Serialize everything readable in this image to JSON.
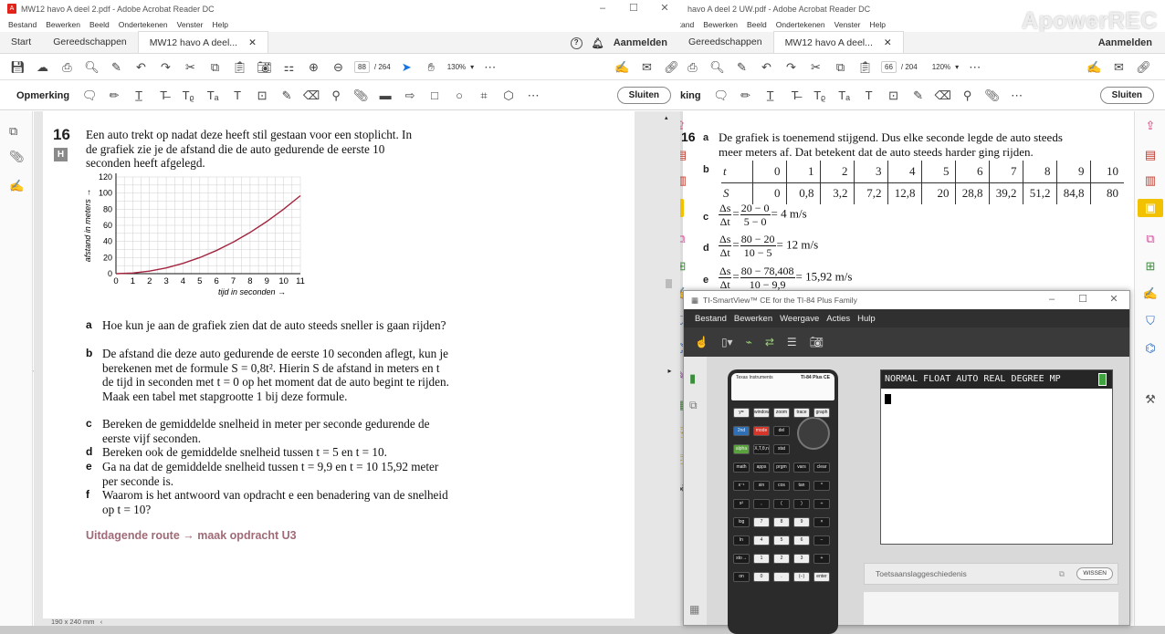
{
  "left_window": {
    "title": "MW12 havo A deel 2.pdf - Adobe Acrobat Reader DC",
    "menu": [
      "Bestand",
      "Bewerken",
      "Beeld",
      "Ondertekenen",
      "Venster",
      "Help"
    ],
    "tabs": {
      "start": "Start",
      "tools": "Gereedschappen",
      "doc": "MW12 havo A deel..."
    },
    "signin": "Aanmelden",
    "page_current": "88",
    "page_total": "/ 264",
    "zoom": "130%",
    "annot_label": "Opmerking",
    "close_label": "Sluiten",
    "status_size": "190 x 240 mm"
  },
  "exercise": {
    "number": "16",
    "badge": "H",
    "intro": "Een auto trekt op nadat deze heeft stil gestaan voor een stoplicht. In de grafiek zie je de afstand die de auto gedurende de eerste 10 seconden heeft afgelegd.",
    "questions": [
      {
        "letter": "a",
        "text": "Hoe kun je aan de grafiek zien dat de auto steeds sneller is gaan rijden?"
      },
      {
        "letter": "b",
        "text": "De afstand die deze auto gedurende de eerste 10 seconden aflegt, kun je berekenen met de formule S = 0,8t². Hierin S de afstand in meters en t de tijd in seconden met t = 0 op het moment dat de auto begint te rijden. Maak een tabel met stapgrootte 1 bij deze formule."
      },
      {
        "letter": "c",
        "text": "Bereken de gemiddelde snelheid in meter per seconde gedurende de eerste vijf seconden."
      },
      {
        "letter": "d",
        "text": "Bereken ook de gemiddelde snelheid tussen t = 5 en t = 10."
      },
      {
        "letter": "e",
        "text": "Ga na dat de gemiddelde snelheid tussen t = 9,9 en t = 10 15,92 meter per seconde is."
      },
      {
        "letter": "f",
        "text": "Waarom is het antwoord van opdracht e een benadering van de snelheid op t = 10?"
      }
    ],
    "route": "Uitdagende route → maak opdracht U3"
  },
  "chart_data": {
    "type": "line",
    "xlabel": "tijd in seconden →",
    "ylabel": "afstand in meters →",
    "xlim": [
      0,
      11
    ],
    "ylim": [
      0,
      120
    ],
    "x_ticks": [
      "0",
      "1",
      "2",
      "3",
      "4",
      "5",
      "6",
      "7",
      "8",
      "9",
      "10",
      "11"
    ],
    "y_ticks": [
      "0",
      "20",
      "40",
      "60",
      "80",
      "100",
      "120"
    ],
    "grid": true,
    "series": [
      {
        "x": [
          0,
          1,
          2,
          3,
          4,
          5,
          6,
          7,
          8,
          9,
          10,
          11
        ],
        "values": [
          0,
          0.8,
          3.2,
          7.2,
          12.8,
          20,
          28.8,
          39.2,
          51.2,
          64.8,
          80,
          96.8
        ],
        "color": "#a3243f"
      }
    ]
  },
  "right_window": {
    "title": "havo A deel 2 UW.pdf - Adobe Acrobat Reader DC",
    "menu": [
      "Bestand",
      "Bewerken",
      "Beeld",
      "Ondertekenen",
      "Venster",
      "Help"
    ],
    "tabs": {
      "tools": "Gereedschappen",
      "doc": "MW12 havo A deel..."
    },
    "signin": "Aanmelden",
    "page_current": "66",
    "page_total": "/ 204",
    "zoom": "120%",
    "annot_label": "king",
    "close_label": "Sluiten",
    "watermark": "ApowerREC"
  },
  "answers": {
    "number": "16",
    "a_letter": "a",
    "a_text": "De grafiek is toenemend stijgend. Dus elke seconde legde de auto steeds meer meters af. Dat betekent dat de auto steeds harder ging rijden.",
    "b_letter": "b",
    "table_t": [
      "t",
      "0",
      "1",
      "2",
      "3",
      "4",
      "5",
      "6",
      "7",
      "8",
      "9",
      "10"
    ],
    "table_s": [
      "S",
      "0",
      "0,8",
      "3,2",
      "7,2",
      "12,8",
      "20",
      "28,8",
      "39,2",
      "51,2",
      "84,8",
      "80"
    ],
    "c": {
      "letter": "c",
      "ds": "Δs",
      "dt": "Δt",
      "num": "20 − 0",
      "den": "5 − 0",
      "result": "= 4 m/s"
    },
    "d": {
      "letter": "d",
      "ds": "Δs",
      "dt": "Δt",
      "num": "80 − 20",
      "den": "10 − 5",
      "result": "= 12 m/s"
    },
    "e": {
      "letter": "e",
      "ds": "Δs",
      "dt": "Δt",
      "num": "80 − 78,408",
      "den": "10 − 9,9",
      "result": "= 15,92 m/s"
    }
  },
  "calculator": {
    "title": "TI-SmartView™ CE for the TI-84 Plus Family",
    "menu": [
      "Bestand",
      "Bewerken",
      "Weergave",
      "Acties",
      "Hulp"
    ],
    "brand": "Texas Instruments",
    "model": "TI-84 Plus CE",
    "status": "NORMAL FLOAT AUTO REAL DEGREE MP",
    "history_label": "Toetsaanslaggeschiedenis",
    "clear_label": "WISSEN",
    "keys": [
      [
        "y=",
        "window",
        "zoom",
        "trace",
        "graph"
      ],
      [
        "2nd",
        "mode",
        "del"
      ],
      [
        "alpha",
        "X,T,θ,n",
        "stat"
      ],
      [
        "math",
        "apps",
        "prgm",
        "vars",
        "clear"
      ],
      [
        "x⁻¹",
        "sin",
        "cos",
        "tan",
        "^"
      ],
      [
        "x²",
        ",",
        "(",
        ")",
        "÷"
      ],
      [
        "log",
        "7",
        "8",
        "9",
        "×"
      ],
      [
        "ln",
        "4",
        "5",
        "6",
        "−"
      ],
      [
        "sto→",
        "1",
        "2",
        "3",
        "+"
      ],
      [
        "on",
        "0",
        ".",
        "(−)",
        "enter"
      ]
    ]
  }
}
